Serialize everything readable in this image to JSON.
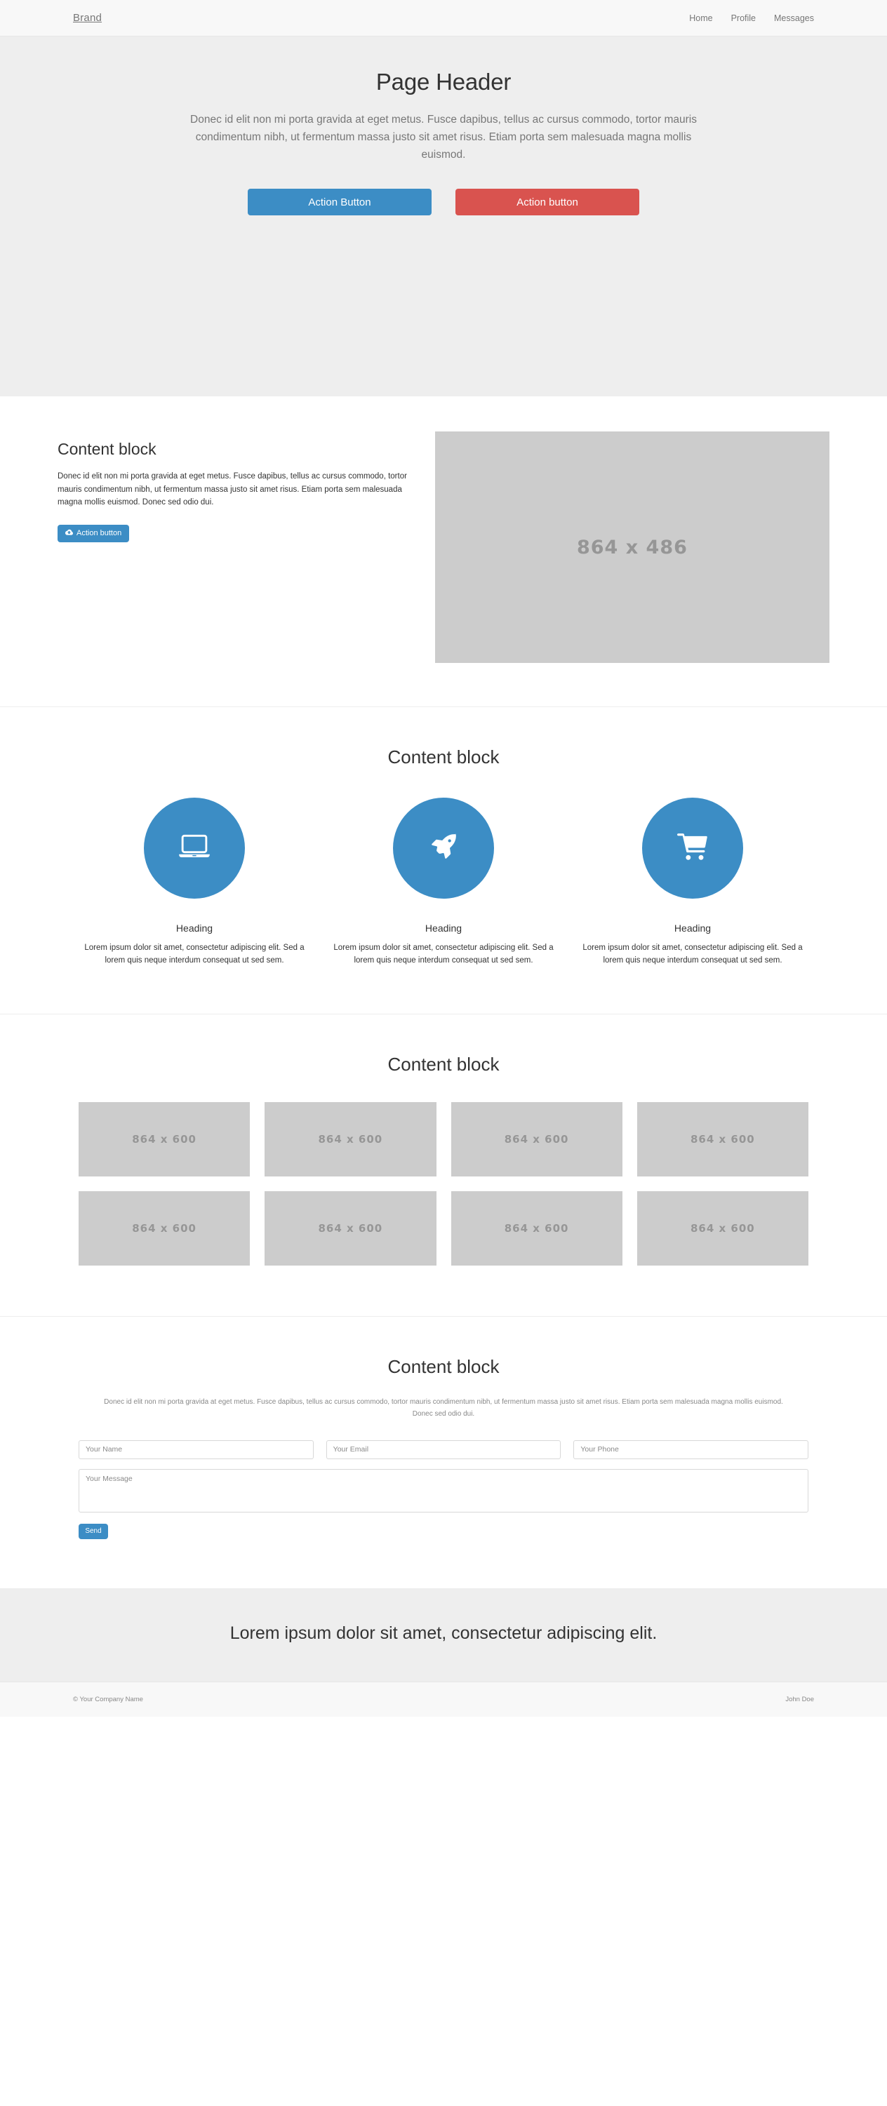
{
  "navbar": {
    "brand": "Brand",
    "links": [
      {
        "label": "Home"
      },
      {
        "label": "Profile"
      },
      {
        "label": "Messages"
      }
    ]
  },
  "hero": {
    "title": "Page Header",
    "description": "Donec id elit non mi porta gravida at eget metus. Fusce dapibus, tellus ac cursus commodo, tortor mauris condimentum nibh, ut fermentum massa justo sit amet risus. Etiam porta sem malesuada magna mollis euismod.",
    "primary_button": "Action Button",
    "danger_button": "Action button",
    "primary_color": "#3c8dc5",
    "danger_color": "#d9534f",
    "background_color": "#eeeeee"
  },
  "content_block_one": {
    "title": "Content block",
    "paragraph": "Donec id elit non mi porta gravida at eget metus. Fusce dapibus, tellus ac cursus commodo, tortor mauris condimentum nibh, ut fermentum massa justo sit amet risus. Etiam porta sem malesuada magna mollis euismod. Donec sed odio dui.",
    "button_label": "Action button",
    "button_icon": "cloud-upload-icon",
    "image_placeholder": "864 x 486"
  },
  "features": {
    "title": "Content block",
    "items": [
      {
        "icon": "laptop-icon",
        "heading": "Heading",
        "text": "Lorem ipsum dolor sit amet, consectetur adipiscing elit. Sed a lorem quis neque interdum consequat ut sed sem."
      },
      {
        "icon": "rocket-icon",
        "heading": "Heading",
        "text": "Lorem ipsum dolor sit amet, consectetur adipiscing elit. Sed a lorem quis neque interdum consequat ut sed sem."
      },
      {
        "icon": "shopping-cart-icon",
        "heading": "Heading",
        "text": "Lorem ipsum dolor sit amet, consectetur adipiscing elit. Sed a lorem quis neque interdum consequat ut sed sem."
      }
    ],
    "circle_color": "#3c8dc5"
  },
  "gallery": {
    "title": "Content block",
    "thumbnails": [
      {
        "label": "864 x 600"
      },
      {
        "label": "864 x 600"
      },
      {
        "label": "864 x 600"
      },
      {
        "label": "864 x 600"
      },
      {
        "label": "864 x 600"
      },
      {
        "label": "864 x 600"
      },
      {
        "label": "864 x 600"
      },
      {
        "label": "864 x 600"
      }
    ]
  },
  "contact": {
    "title": "Content block",
    "lead": "Donec id elit non mi porta gravida at eget metus. Fusce dapibus, tellus ac cursus commodo, tortor mauris condimentum nibh, ut fermentum massa justo sit amet risus. Etiam porta sem malesuada magna mollis euismod. Donec sed odio dui.",
    "name_placeholder": "Your Name",
    "email_placeholder": "Your Email",
    "phone_placeholder": "Your Phone",
    "message_placeholder": "Your Message",
    "name_value": "",
    "email_value": "",
    "phone_value": "",
    "message_value": "",
    "send_label": "Send"
  },
  "cta": {
    "text": "Lorem ipsum dolor sit amet, consectetur adipiscing elit.",
    "background_color": "#eeeeee"
  },
  "footer": {
    "copyright": "© Your Company Name",
    "author": "John Doe"
  }
}
